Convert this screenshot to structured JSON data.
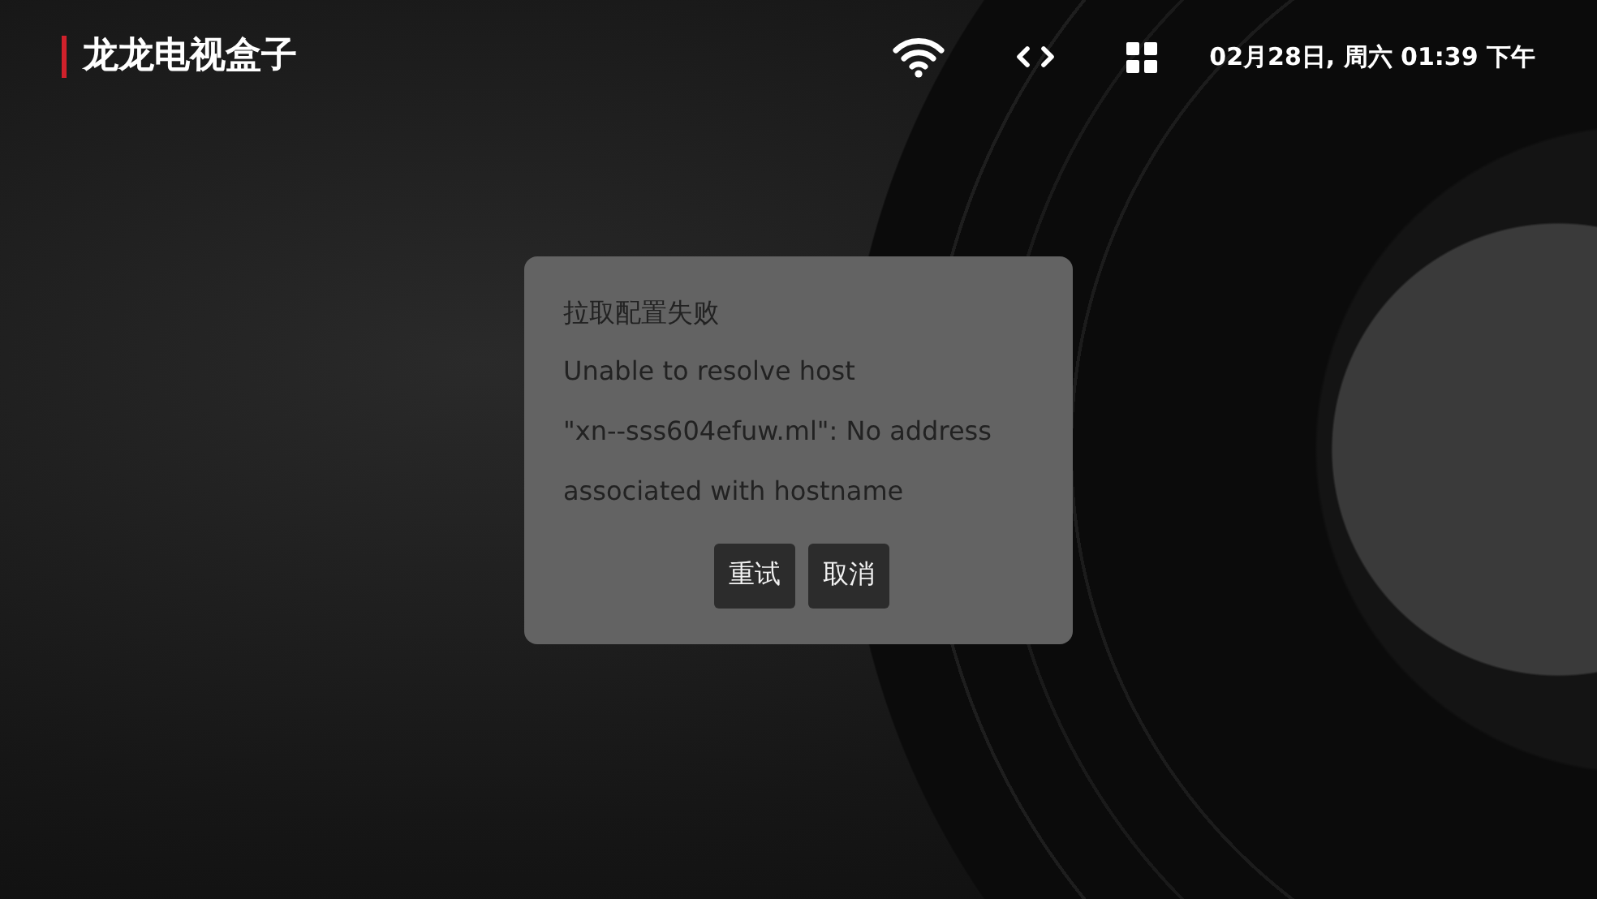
{
  "header": {
    "title": "龙龙电视盒子",
    "datetime": "02月28日, 周六 01:39 下午"
  },
  "dialog": {
    "title": "拉取配置失败",
    "message_lines": [
      "Unable to resolve host",
      "\"xn--sss604efuw.ml\": No address",
      "associated with hostname"
    ],
    "buttons": [
      "重试",
      "取消"
    ]
  }
}
